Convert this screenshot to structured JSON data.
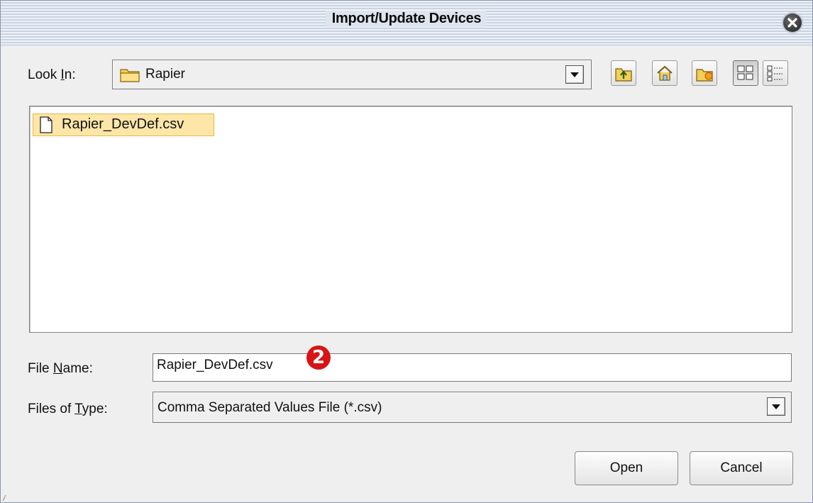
{
  "window": {
    "title": "Import/Update Devices"
  },
  "look_in": {
    "label_pre": "Look ",
    "label_mnemonic": "I",
    "label_post": "n:",
    "value": "Rapier"
  },
  "toolbar": {
    "icons": [
      "folder-up-icon",
      "home-icon",
      "new-folder-icon",
      "list-view-icon",
      "details-view-icon"
    ]
  },
  "files": [
    {
      "name": "Rapier_DevDef.csv",
      "selected": true
    }
  ],
  "file_name": {
    "label_pre": "File ",
    "label_mnemonic": "N",
    "label_post": "ame:",
    "value": "Rapier_DevDef.csv"
  },
  "files_of_type": {
    "label_pre": "Files of ",
    "label_mnemonic": "T",
    "label_post": "ype:",
    "value": "Comma Separated Values File (*.csv)"
  },
  "callout": {
    "number": "2"
  },
  "buttons": {
    "open": "Open",
    "cancel": "Cancel"
  },
  "colors": {
    "selection": "#fde6a8",
    "callout": "#d81414"
  }
}
